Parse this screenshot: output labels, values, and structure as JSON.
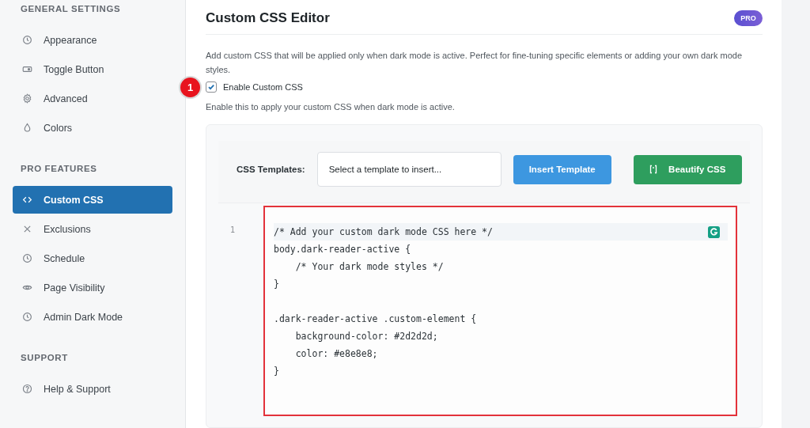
{
  "sidebar": {
    "sections": [
      {
        "heading": "GENERAL SETTINGS",
        "items": [
          {
            "label": "Appearance",
            "kind": "clock",
            "selected": false
          },
          {
            "label": "Toggle Button",
            "kind": "toggle",
            "selected": false
          },
          {
            "label": "Advanced",
            "kind": "gear",
            "selected": false
          },
          {
            "label": "Colors",
            "kind": "drop",
            "selected": false
          }
        ]
      },
      {
        "heading": "PRO FEATURES",
        "items": [
          {
            "label": "Custom CSS",
            "kind": "code",
            "selected": true
          },
          {
            "label": "Exclusions",
            "kind": "x",
            "selected": false
          },
          {
            "label": "Schedule",
            "kind": "clock",
            "selected": false
          },
          {
            "label": "Page Visibility",
            "kind": "eye",
            "selected": false
          },
          {
            "label": "Admin Dark Mode",
            "kind": "clock",
            "selected": false
          }
        ]
      },
      {
        "heading": "SUPPORT",
        "items": [
          {
            "label": "Help & Support",
            "kind": "help",
            "selected": false
          }
        ]
      }
    ]
  },
  "main": {
    "title": "Custom CSS Editor",
    "badge": "PRO",
    "description": "Add custom CSS that will be applied only when dark mode is active. Perfect for fine-tuning specific elements or adding your own dark mode styles.",
    "annotation": "1",
    "enable": {
      "label": "Enable Custom CSS",
      "checked": true
    },
    "help": "Enable this to apply your custom CSS when dark mode is active.",
    "templates": {
      "label": "CSS Templates:",
      "placeholder": "Select a template to insert...",
      "insert_button": "Insert Template",
      "beautify_button": "Beautify CSS"
    },
    "editor": {
      "line_number": "1",
      "blocks": [
        [
          "/* Add your custom dark mode CSS here */",
          "body.dark-reader-active {",
          "    /* Your dark mode styles */",
          "}"
        ],
        [
          ".dark-reader-active .custom-element {",
          "    background-color: #2d2d2d;",
          "    color: #e8e8e8;",
          "}"
        ]
      ]
    }
  }
}
